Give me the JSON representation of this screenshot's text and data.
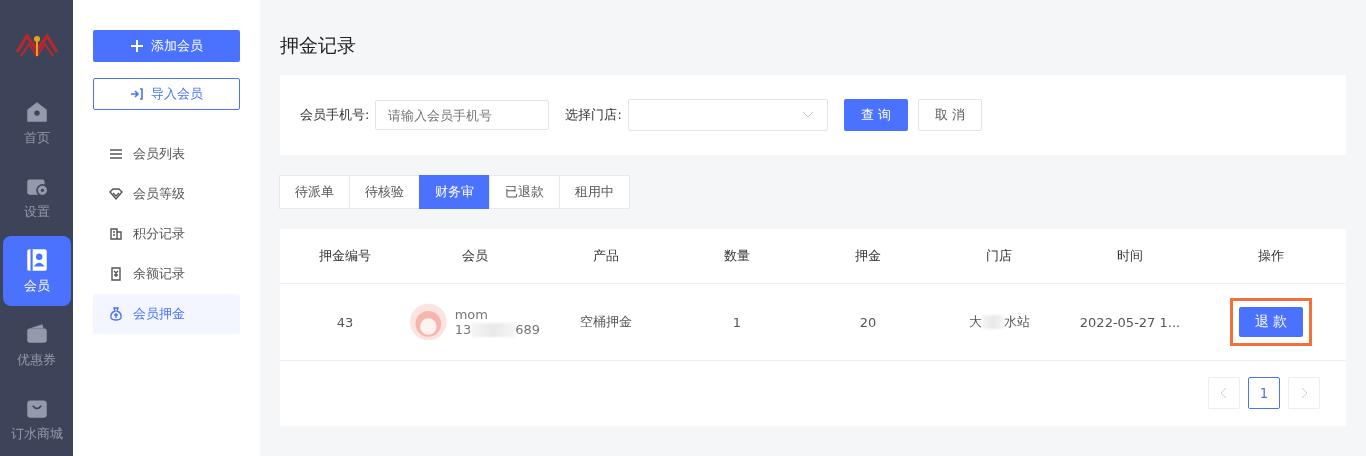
{
  "nav": [
    {
      "label": "首页",
      "selected": false
    },
    {
      "label": "设置",
      "selected": false
    },
    {
      "label": "会员",
      "selected": true
    },
    {
      "label": "优惠券",
      "selected": false
    },
    {
      "label": "订水商城",
      "selected": false
    }
  ],
  "side": {
    "add_button": "添加会员",
    "import_button": "导入会员",
    "items": [
      {
        "label": "会员列表",
        "selected": false
      },
      {
        "label": "会员等级",
        "selected": false
      },
      {
        "label": "积分记录",
        "selected": false
      },
      {
        "label": "余额记录",
        "selected": false
      },
      {
        "label": "会员押金",
        "selected": true
      }
    ]
  },
  "page_title": "押金记录",
  "filter": {
    "phone_label": "会员手机号:",
    "phone_placeholder": "请输入会员手机号",
    "store_label": "选择门店:",
    "query_button": "查 询",
    "cancel_button": "取 消"
  },
  "tabs": [
    {
      "label": "待派单",
      "selected": false
    },
    {
      "label": "待核验",
      "selected": false
    },
    {
      "label": "财务审",
      "selected": true
    },
    {
      "label": "已退款",
      "selected": false
    },
    {
      "label": "租用中",
      "selected": false
    }
  ],
  "table": {
    "columns": [
      "押金编号",
      "会员",
      "产品",
      "数量",
      "押金",
      "门店",
      "时间",
      "操作"
    ],
    "rows": [
      {
        "id": "43",
        "member_name": "mom",
        "phone_start": "13",
        "phone_end": "689",
        "product": "空桶押金",
        "qty": "1",
        "deposit": "20",
        "store_start": "大",
        "store_end": "水站",
        "time": "2022-05-27 1...",
        "action": "退 款",
        "highlighted": true
      }
    ]
  },
  "pagination": {
    "pages": [
      {
        "label": "1",
        "selected": true
      }
    ]
  }
}
